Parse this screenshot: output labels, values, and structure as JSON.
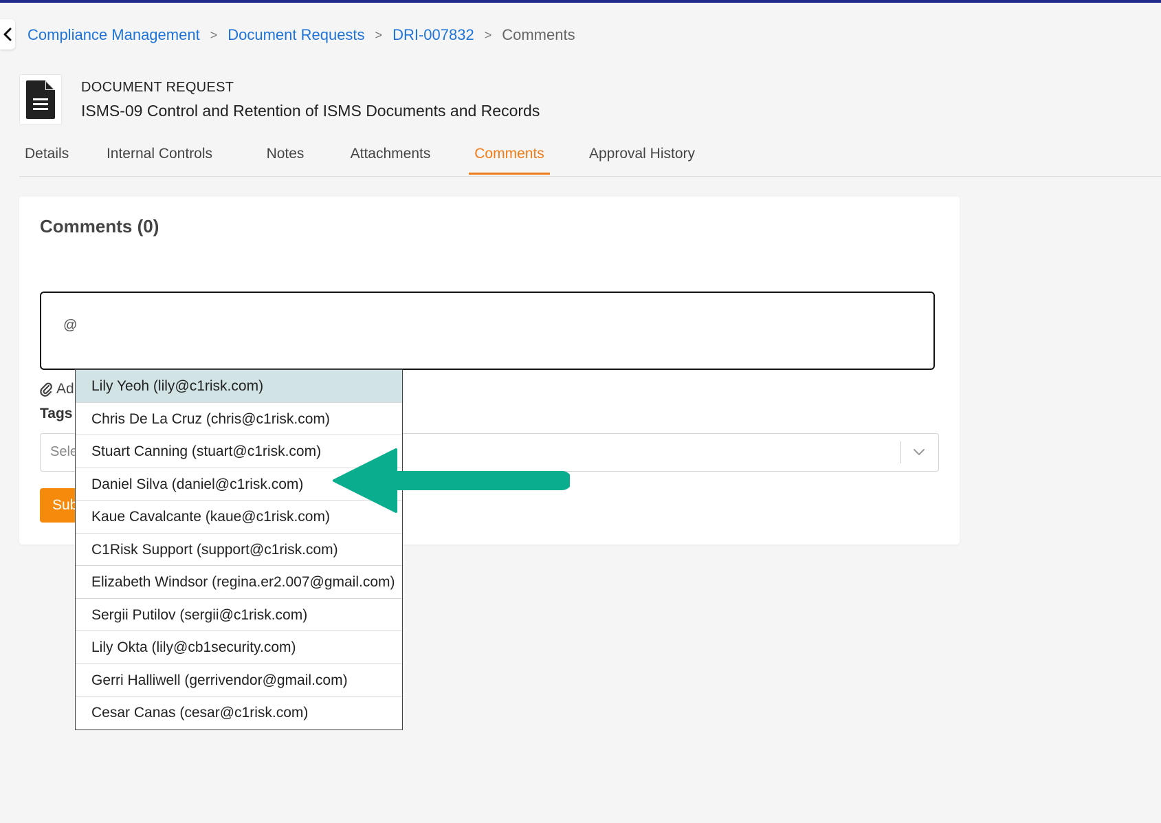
{
  "breadcrumb": {
    "items": [
      "Compliance Management",
      "Document Requests",
      "DRI-007832"
    ],
    "separator": ">",
    "current": "Comments"
  },
  "header": {
    "type_label": "DOCUMENT REQUEST",
    "title": "ISMS-09 Control and Retention of ISMS Documents and Records"
  },
  "tabs": [
    {
      "label": "Details"
    },
    {
      "label": "Internal Controls"
    },
    {
      "label": "Notes"
    },
    {
      "label": "Attachments"
    },
    {
      "label": "Comments",
      "active": true
    },
    {
      "label": "Approval History"
    }
  ],
  "comments": {
    "title": "Comments (0)",
    "input_value": "@",
    "attach_label": "Ad",
    "tags_label": "Tags",
    "tags_placeholder": "Sele",
    "submit_label": "Sub"
  },
  "mention_dropdown": {
    "options": [
      "Lily Yeoh (lily@c1risk.com)",
      "Chris De La Cruz (chris@c1risk.com)",
      "Stuart Canning (stuart@c1risk.com)",
      "Daniel Silva (daniel@c1risk.com)",
      "Kaue Cavalcante (kaue@c1risk.com)",
      "C1Risk Support (support@c1risk.com)",
      "Elizabeth Windsor (regina.er2.007@gmail.com)",
      "Sergii Putilov (sergii@c1risk.com)",
      "Lily Okta (lily@cb1security.com)",
      "Gerri Halliwell (gerrivendor@gmail.com)",
      "Cesar Canas (cesar@c1risk.com)"
    ],
    "highlighted_index": 0
  },
  "colors": {
    "accent": "#f07b17",
    "link": "#1e73d8",
    "arrow": "#0aae8e",
    "highlight": "#d1e3e4"
  }
}
